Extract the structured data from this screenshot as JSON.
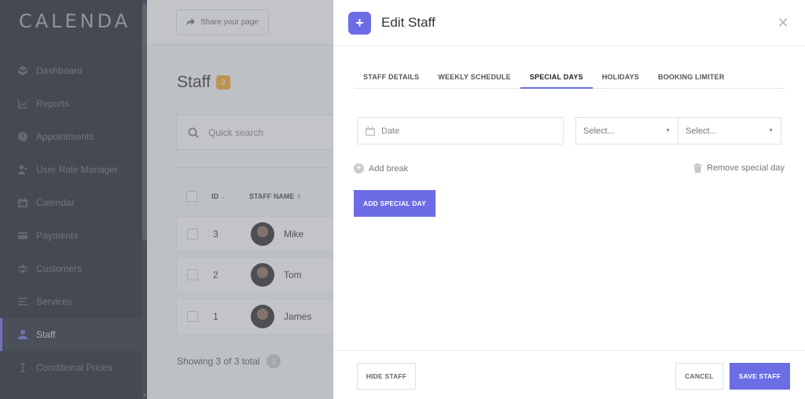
{
  "sidebar": {
    "logo": "CALENDA",
    "items": [
      {
        "label": "Dashboard",
        "icon": "dashboard-icon"
      },
      {
        "label": "Reports",
        "icon": "chart-icon"
      },
      {
        "label": "Appointments",
        "icon": "clock-icon"
      },
      {
        "label": "User Role Manager",
        "icon": "user-plus-icon"
      },
      {
        "label": "Calendar",
        "icon": "calendar-icon"
      },
      {
        "label": "Payments",
        "icon": "credit-card-icon"
      },
      {
        "label": "Customers",
        "icon": "users-icon"
      },
      {
        "label": "Services",
        "icon": "list-icon"
      },
      {
        "label": "Staff",
        "icon": "user-icon",
        "active": true
      },
      {
        "label": "Conditional Prices",
        "icon": "cursor-icon"
      }
    ]
  },
  "main": {
    "share_label": "Share your page",
    "title": "Staff",
    "count": "3",
    "search_placeholder": "Quick search",
    "columns": {
      "id": "ID",
      "name": "STAFF NAME"
    },
    "rows": [
      {
        "id": "3",
        "name": "Mike"
      },
      {
        "id": "2",
        "name": "Tom"
      },
      {
        "id": "1",
        "name": "James"
      }
    ],
    "showing": "Showing 3 of 3 total",
    "page": "1"
  },
  "modal": {
    "title": "Edit Staff",
    "tabs": [
      "STAFF DETAILS",
      "WEEKLY SCHEDULE",
      "SPECIAL DAYS",
      "HOLIDAYS",
      "BOOKING LIMITER"
    ],
    "active_tab": "SPECIAL DAYS",
    "date_placeholder": "Date",
    "select1": "Select...",
    "select2": "Select...",
    "add_break": "Add break",
    "remove_special_day": "Remove special day",
    "add_special_day": "ADD SPECIAL DAY",
    "hide_staff": "HIDE STAFF",
    "cancel": "CANCEL",
    "save_staff": "SAVE STAFF"
  },
  "colors": {
    "accent": "#6c6ce5",
    "sidebar_bg": "#1c1f29",
    "badge": "#f5a623"
  }
}
